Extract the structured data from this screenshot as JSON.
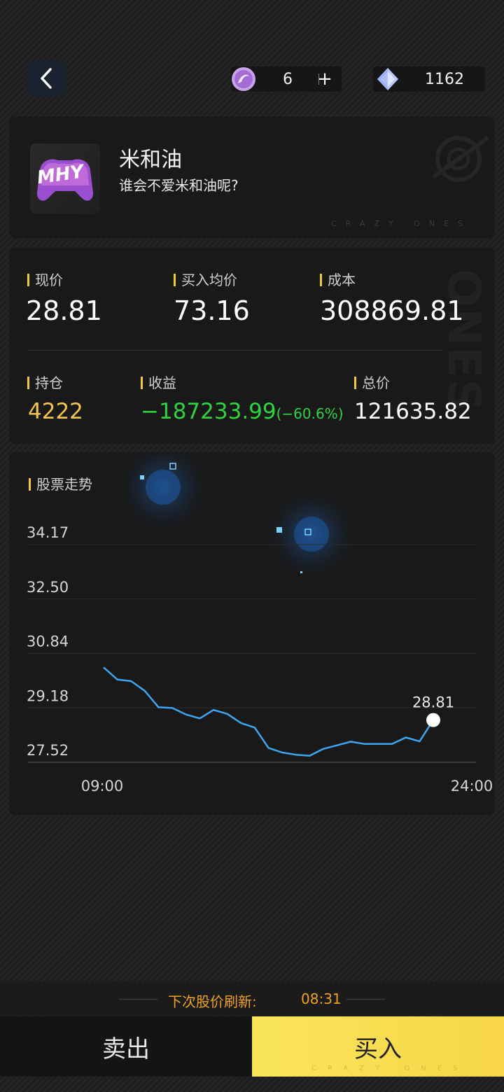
{
  "header": {
    "ticket_count": "6",
    "ticket_add": "+",
    "gem_count": "1162"
  },
  "stock": {
    "logo_text": "MHY",
    "name": "米和油",
    "description": "谁会不爱米和油呢?",
    "watermark": "CRAZY ONES"
  },
  "stats": {
    "current_price_label": "现价",
    "current_price": "28.81",
    "avg_buy_label": "买入均价",
    "avg_buy": "73.16",
    "cost_label": "成本",
    "cost": "308869.81",
    "position_label": "持仓",
    "position": "4222",
    "gain_label": "收益",
    "gain": "−187233.99",
    "gain_pct": "(−60.6%)",
    "total_label": "总价",
    "total": "121635.82",
    "side_watermark": "ONES"
  },
  "chart_data": {
    "type": "line",
    "title": "股票走势",
    "x_tick_labels": [
      "09:00",
      "24:00"
    ],
    "y_tick_labels": [
      "34.17",
      "32.50",
      "30.84",
      "29.18",
      "27.52"
    ],
    "ylim": [
      27.52,
      34.17
    ],
    "series": [
      {
        "color": "#3ea6f0",
        "values": [
          30.42,
          30.05,
          30.0,
          29.7,
          29.2,
          29.18,
          28.98,
          28.86,
          29.12,
          29.0,
          28.72,
          28.58,
          27.96,
          27.82,
          27.75,
          27.72,
          27.93,
          28.04,
          28.15,
          28.08,
          28.08,
          28.08,
          28.28,
          28.16,
          28.81
        ]
      }
    ],
    "last_value_label": "28.81",
    "grid": true
  },
  "footer": {
    "refresh_label": "下次股价刷新:",
    "refresh_time": "08:31",
    "sell_label": "卖出",
    "buy_label": "买入",
    "buy_watermark": "CRAZY ONES"
  },
  "colors": {
    "accent_yellow": "#f4c63a",
    "gain_green": "#2fd23f",
    "refresh_orange": "#f0a21f",
    "line_blue": "#3ea6f0"
  }
}
